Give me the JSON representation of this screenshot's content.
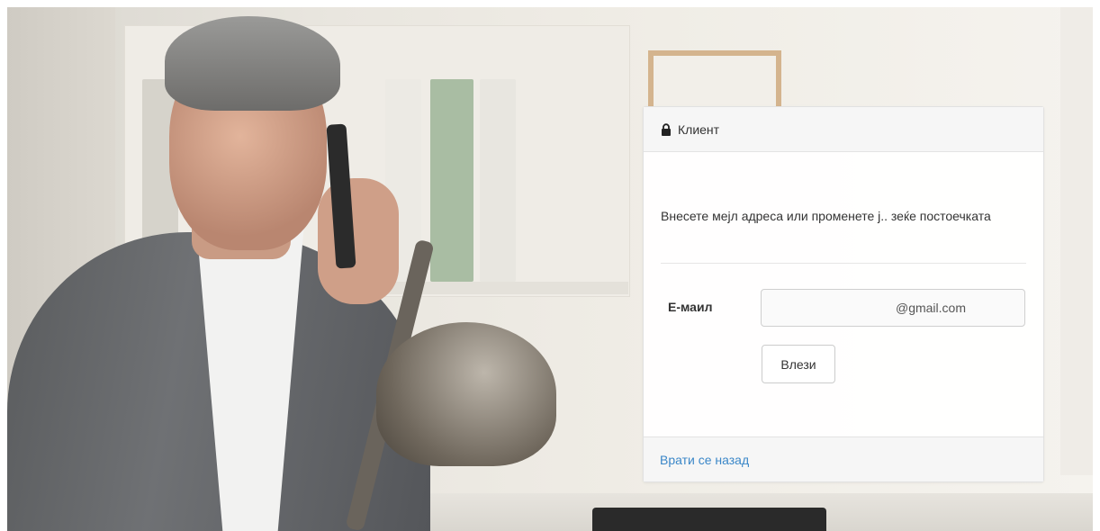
{
  "panel": {
    "header_title": "Клиент",
    "instructions": "Внесете мејл адреса или променете ј.. зеќе постоечката",
    "email_label": "Е-маил",
    "email_value": "@gmail.com",
    "login_label": "Влези",
    "back_link": "Врати се назад"
  },
  "icons": {
    "header": "lock-icon"
  },
  "colors": {
    "link": "#3b87c8",
    "text": "#333333",
    "border": "#cfcfcf"
  }
}
